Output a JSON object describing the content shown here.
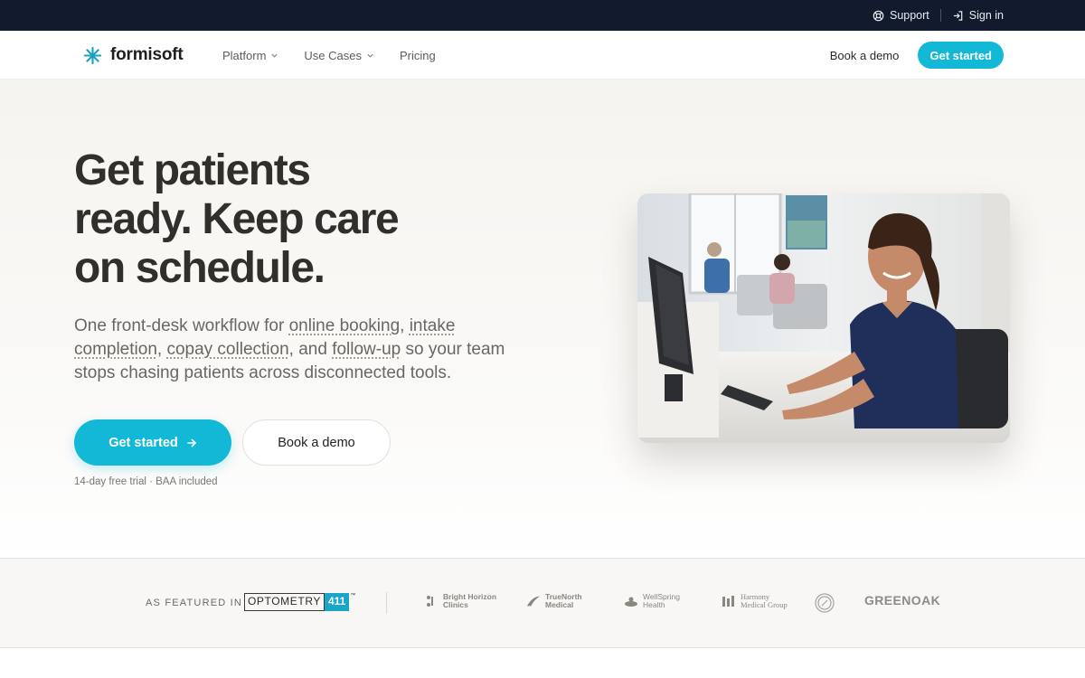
{
  "utility": {
    "support_label": "Support",
    "signin_label": "Sign in"
  },
  "nav": {
    "brand": "formisoft",
    "items": [
      {
        "label": "Platform",
        "has_dropdown": true
      },
      {
        "label": "Use Cases",
        "has_dropdown": true
      },
      {
        "label": "Pricing",
        "has_dropdown": false
      }
    ],
    "demo_label": "Book a demo",
    "cta_label": "Get started"
  },
  "hero": {
    "title_lines": [
      "Get patients",
      "ready. Keep care",
      "on schedule."
    ],
    "subtitle": {
      "p1": "One front-desk workflow for ",
      "link1": "online booking",
      "p2": ", ",
      "link2": "intake completion",
      "p3": ", ",
      "link3": "copay collection",
      "p4": ", and ",
      "link4": "follow-up",
      "p5": " so your team stops chasing patients across disconnected tools."
    },
    "primary_cta": "Get started",
    "secondary_cta": "Book a demo",
    "note": "14-day free trial · BAA included",
    "image_alt": "Front desk staff member working at a computer in a clinic"
  },
  "featured": {
    "label": "AS FEATURED IN",
    "optometry": {
      "text": "OPTOMETRY",
      "num": "411",
      "tm": "™"
    },
    "partners": [
      {
        "name": "Bright Horizon Clinics",
        "line1": "Bright Horizon",
        "line2": "Clinics"
      },
      {
        "name": "TrueNorth Medical",
        "line1": "TrueNorth",
        "line2": "Medical"
      },
      {
        "name": "WellSpring Health",
        "line1": "WellSpring",
        "line2": "Health"
      },
      {
        "name": "Harmony Medical Group",
        "line1": "Harmony",
        "line2": "Medical Group"
      },
      {
        "name": "seal-logo"
      },
      {
        "name": "GREENOAK",
        "line1": "GREENOAK"
      }
    ]
  },
  "colors": {
    "accent": "#13b8d6",
    "utility_bg": "#121a2e",
    "heading": "#322e2b"
  }
}
